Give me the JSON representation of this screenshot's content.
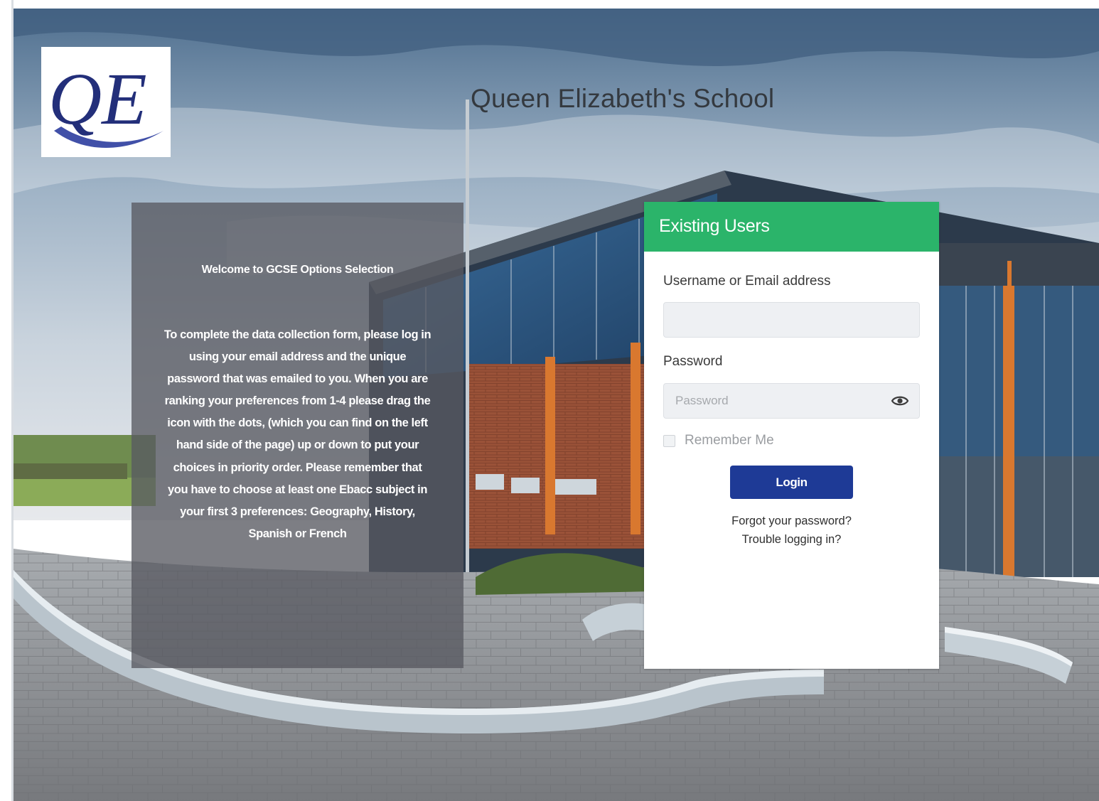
{
  "logo": {
    "text": "QE"
  },
  "header": {
    "school_name": "Queen Elizabeth's School"
  },
  "welcome": {
    "heading": "Welcome to GCSE Options Selection",
    "body": "To complete the data collection form, please log in using your email address and the unique password that was emailed to you. When you are ranking your preferences from 1-4 please drag the icon with the dots, (which you can find on the left hand side of the page) up or down to put your choices in priority order. Please remember that you have to choose at least one Ebacc subject in your first 3 preferences: Geography, History, Spanish or French"
  },
  "login": {
    "title": "Existing Users",
    "username_label": "Username or Email address",
    "username_value": "",
    "username_placeholder": "",
    "password_label": "Password",
    "password_value": "",
    "password_placeholder": "Password",
    "password_toggle_icon": "eye-icon",
    "remember_label": "Remember Me",
    "remember_checked": false,
    "login_button": "Login",
    "forgot_link": "Forgot your password?",
    "trouble_link": "Trouble logging in?"
  },
  "colors": {
    "header_green": "#2bb46a",
    "login_blue": "#1e3a96",
    "panel_overlay": "#585a62",
    "logo_navy": "#232f7a"
  }
}
